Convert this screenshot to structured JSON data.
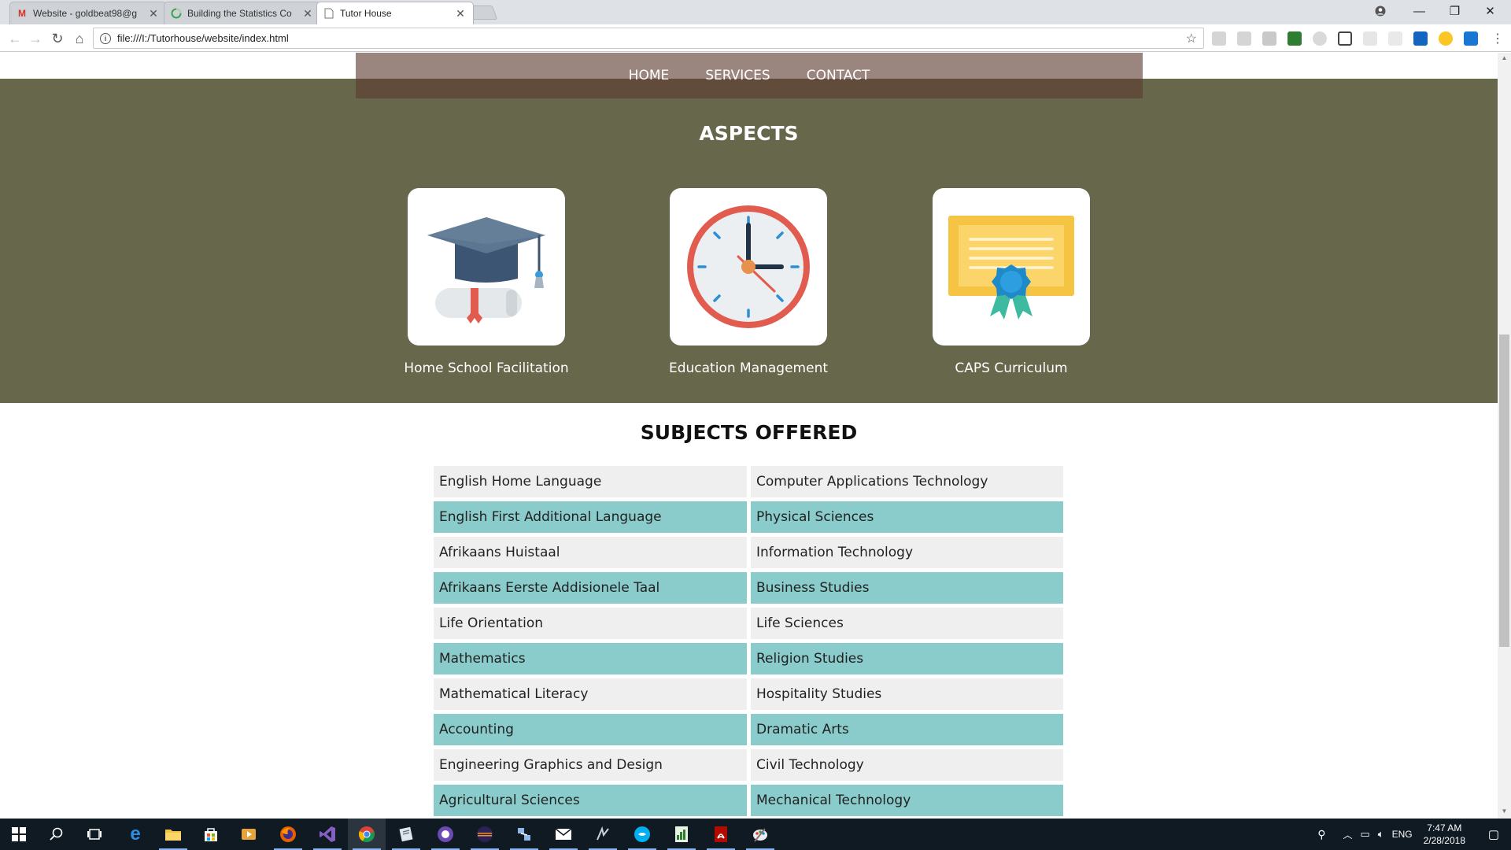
{
  "browser": {
    "tabs": [
      {
        "title": "Website - goldbeat98@g",
        "icon": "gmail-icon",
        "icon_color": "#d93025"
      },
      {
        "title": "Building the Statistics Co",
        "icon": "loading-icon",
        "icon_color": "#3fa34d"
      },
      {
        "title": "Tutor House",
        "icon": "page-icon",
        "icon_color": "#777777"
      }
    ],
    "url": "file:///I:/Tutorhouse/website/index.html"
  },
  "page": {
    "nav": [
      "HOME",
      "SERVICES",
      "CONTACT"
    ],
    "aspects": {
      "title": "ASPECTS",
      "items": [
        {
          "label": "Home School Facilitation",
          "icon": "graduation-cap-icon"
        },
        {
          "label": "Education Management",
          "icon": "clock-icon"
        },
        {
          "label": "CAPS Curriculum",
          "icon": "certificate-icon"
        }
      ]
    },
    "subjects": {
      "title": "SUBJECTS OFFERED",
      "rows": [
        [
          "English Home Language",
          "Computer Applications Technology"
        ],
        [
          "English First Additional Language",
          "Physical Sciences"
        ],
        [
          "Afrikaans Huistaal",
          "Information Technology"
        ],
        [
          "Afrikaans Eerste Addisionele Taal",
          "Business Studies"
        ],
        [
          "Life Orientation",
          "Life Sciences"
        ],
        [
          "Mathematics",
          "Religion Studies"
        ],
        [
          "Mathematical Literacy",
          "Hospitality Studies"
        ],
        [
          "Accounting",
          "Dramatic Arts"
        ],
        [
          "Engineering Graphics and Design",
          "Civil Technology"
        ],
        [
          "Agricultural Sciences",
          "Mechanical Technology"
        ]
      ]
    },
    "colors": {
      "aspects_bg": "#67674b",
      "nav_bg": "#5e3a30",
      "row_alt": "#89cccb",
      "row_plain": "#efefef"
    }
  },
  "taskbar": {
    "time": "7:47 AM",
    "date": "2/28/2018",
    "language": "ENG"
  }
}
